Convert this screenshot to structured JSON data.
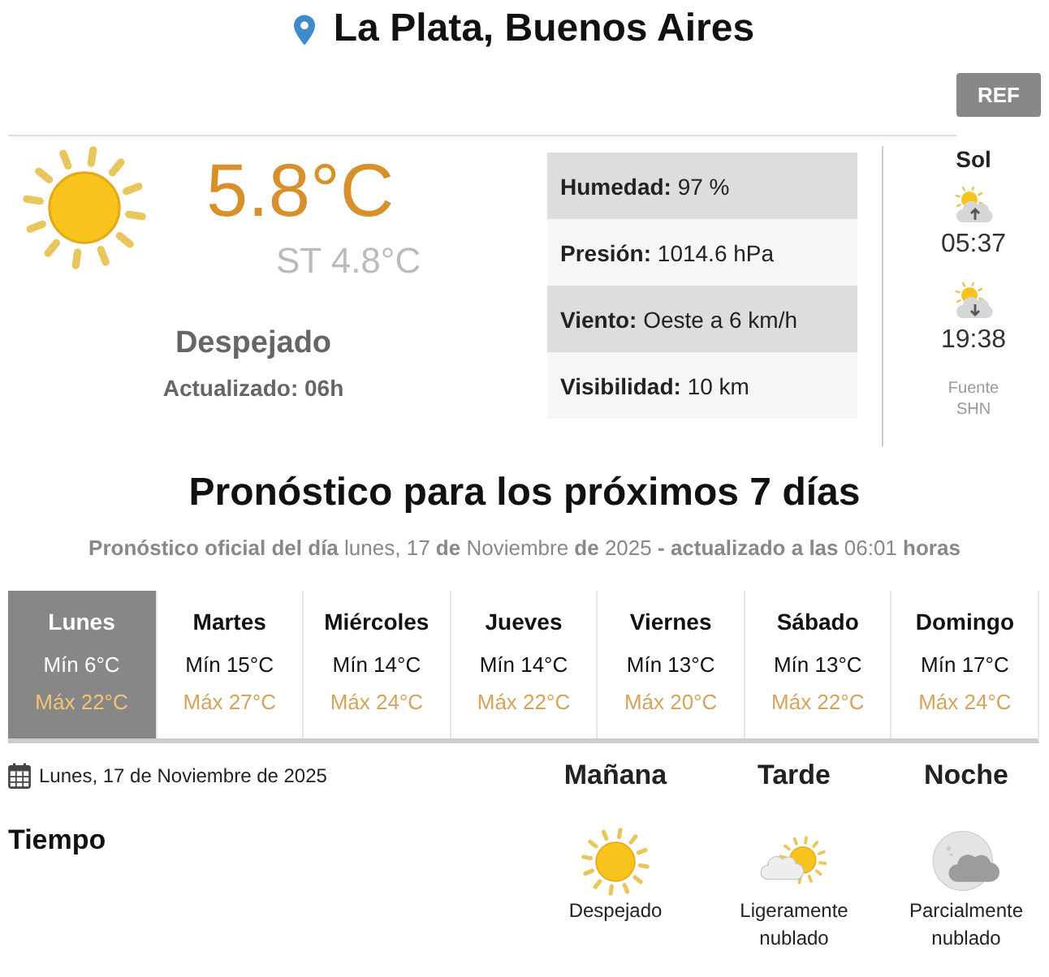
{
  "header": {
    "location": "La Plata, Buenos Aires",
    "ref_button": "REF"
  },
  "current": {
    "kind": "sunny",
    "temperature": "5.8°C",
    "feels_like": "ST 4.8°C",
    "condition": "Despejado",
    "updated": "Actualizado: 06h",
    "details": [
      "**Humedad:** 97 %",
      "**Presión:** 1014.6 hPa",
      "**Viento:** Oeste a 6 km/h",
      "**Visibilidad:** 10 km"
    ]
  },
  "sun": {
    "title": "Sol",
    "sunrise": "05:37",
    "sunset": "19:38",
    "source": "Fuente SHN"
  },
  "forecast": {
    "title": "Pronóstico para los próximos 7 días",
    "subtitle": "**Pronóstico oficial del día** lunes, 17 **de** Noviembre **de** 2025 **- actualizado a las** 06:01 **horas**",
    "days": [
      {
        "name": "Lunes",
        "min": "Mín 6°C",
        "max": "Máx 22°C",
        "selected": true
      },
      {
        "name": "Martes",
        "min": "Mín 15°C",
        "max": "Máx 27°C",
        "selected": false
      },
      {
        "name": "Miércoles",
        "min": "Mín 14°C",
        "max": "Máx 24°C",
        "selected": false
      },
      {
        "name": "Jueves",
        "min": "Mín 14°C",
        "max": "Máx 22°C",
        "selected": false
      },
      {
        "name": "Viernes",
        "min": "Mín 13°C",
        "max": "Máx 20°C",
        "selected": false
      },
      {
        "name": "Sábado",
        "min": "Mín 13°C",
        "max": "Máx 22°C",
        "selected": false
      },
      {
        "name": "Domingo",
        "min": "Mín 17°C",
        "max": "Máx 24°C",
        "selected": false
      }
    ]
  },
  "detail": {
    "date": "Lunes, 17 de Noviembre de 2025",
    "row_label": "Tiempo",
    "periods": [
      {
        "name": "Mañana",
        "kind": "sunny",
        "condition": "Despejado"
      },
      {
        "name": "Tarde",
        "kind": "partly_cloudy",
        "condition": "Ligeramente nublado"
      },
      {
        "name": "Noche",
        "kind": "cloudy_night",
        "condition": "Parcialmente nublado"
      }
    ]
  }
}
